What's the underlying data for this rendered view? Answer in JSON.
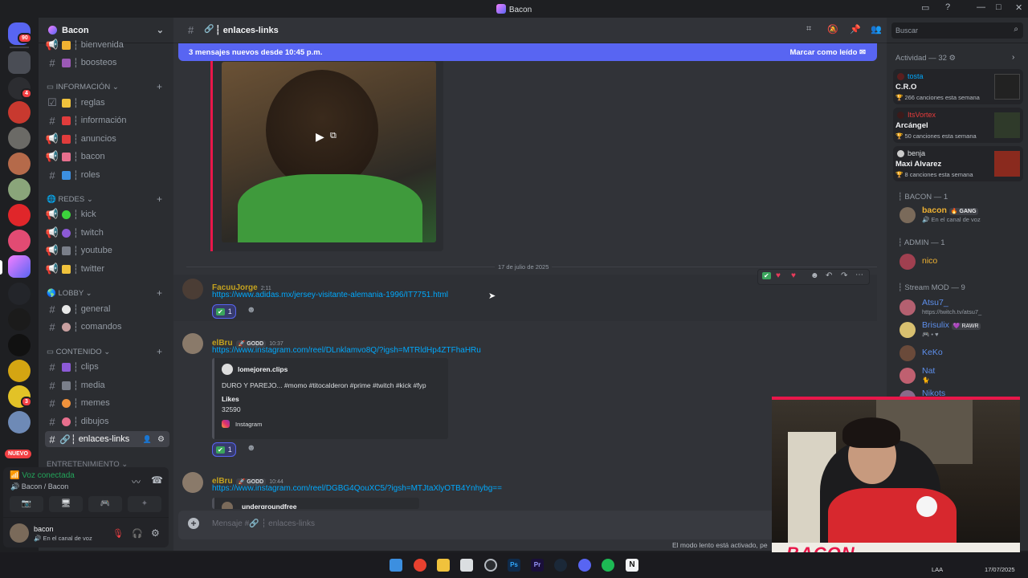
{
  "window": {
    "title": "Bacon"
  },
  "servers": {
    "mention_count": "90",
    "new_label": "NUEVO",
    "badges": [
      "4",
      "3"
    ]
  },
  "server_header": {
    "name": "Bacon"
  },
  "channels": {
    "top": [
      {
        "name": "bienvenida"
      },
      {
        "name": "boosteos"
      }
    ],
    "informacion": {
      "label": "INFORMACIÓN",
      "items": [
        "reglas",
        "información",
        "anuncios",
        "bacon",
        "roles"
      ]
    },
    "redes": {
      "label": "REDES",
      "items": [
        "kick",
        "twitch",
        "youtube",
        "twitter"
      ]
    },
    "lobby": {
      "label": "LOBBY",
      "items": [
        "general",
        "comandos"
      ]
    },
    "contenido": {
      "label": "CONTENIDO",
      "items": [
        "clips",
        "media",
        "memes",
        "dibujos",
        "enlaces-links"
      ]
    },
    "entretenimiento": {
      "label": "ENTRETENIMIENTO"
    }
  },
  "voice": {
    "status": "Voz conectada",
    "channel": "Bacon / Bacon"
  },
  "user": {
    "name": "bacon",
    "status": "En el canal de voz"
  },
  "chat": {
    "channel_name": "enlaces-links",
    "new_messages_banner": "3 mensajes nuevos desde 10:45 p.m.",
    "mark_read": "Marcar como leído",
    "date_divider": "17 de julio de 2025",
    "messages": [
      {
        "author": "FacuuJorge",
        "time": "2:11",
        "link": "https://www.adidas.mx/jersey-visitante-alemania-1996/IT7751.html",
        "reaction_count": "1"
      },
      {
        "author": "elBru",
        "tag": "GODD",
        "time": "10:37",
        "link": "https://www.instagram.com/reel/DLnklamvo8Q/?igsh=MTRldHp4ZTFhaHRu",
        "embed": {
          "author": "lomejoren.clips",
          "text": "DURO Y PAREJO... #momo #titocalderon #prime #twitch #kick #fyp",
          "likes_label": "Likes",
          "likes": "32590",
          "source": "Instagram"
        },
        "reaction_count": "1"
      },
      {
        "author": "elBru",
        "tag": "GODD",
        "time": "10:44",
        "link": "https://www.instagram.com/reel/DGBG4QouXC5/?igsh=MTJtaXlyOTB4Ynhybg==",
        "embed": {
          "author": "undergroundfree"
        }
      }
    ],
    "input_placeholder": "Mensaje #🔗 ┆ enlaces-links",
    "slowmode": "El modo lento está activado, pe"
  },
  "search": {
    "placeholder": "Buscar"
  },
  "activity": {
    "header": "Actividad — 32",
    "cards": [
      {
        "user": "tosta",
        "title": "C.R.O",
        "sub": "266 canciones esta semana"
      },
      {
        "user": "ItsVortex",
        "title": "Arcángel",
        "sub": "50 canciones esta semana"
      },
      {
        "user": "benja",
        "title": "Maxi Alvarez",
        "sub": "8 canciones esta semana"
      }
    ]
  },
  "members": {
    "bacon_cat": "BACON — 1",
    "bacon": {
      "name": "bacon",
      "tag": "GANG",
      "status": "En el canal de voz"
    },
    "admin_cat": "ADMIN — 1",
    "admin": {
      "name": "nico"
    },
    "mod_cat": "Stream MOD — 9",
    "mods": [
      {
        "name": "Atsu7_",
        "status": "https://twitch.tv/atsu7_"
      },
      {
        "name": "Brisulix",
        "tag": "RAWR",
        "status": "🎮 • ♥"
      },
      {
        "name": "KeKo",
        "status": ""
      },
      {
        "name": "Nat",
        "status": "🐈"
      },
      {
        "name": "Nikots",
        "status": ""
      }
    ]
  },
  "webcam": {
    "overlay": "BACON"
  },
  "taskbar": {
    "lang": "LAA",
    "date": "17/07/2025"
  }
}
